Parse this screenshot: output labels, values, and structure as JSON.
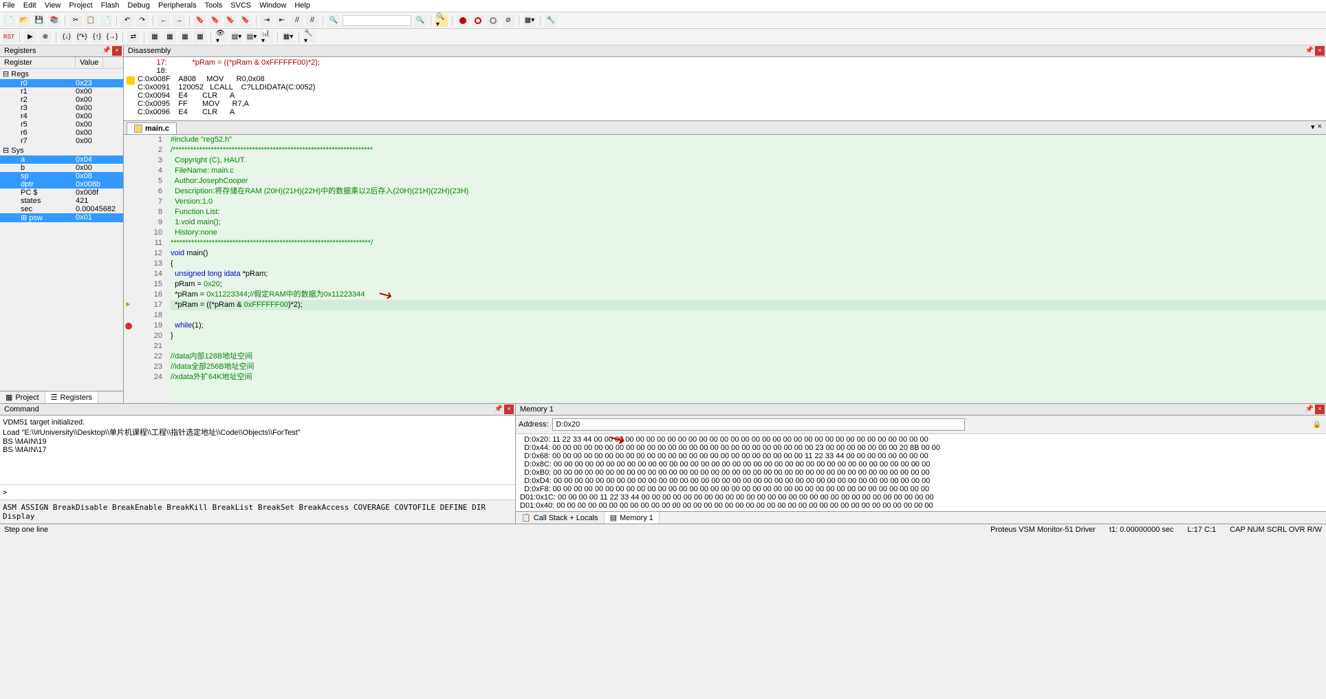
{
  "menu": [
    "File",
    "Edit",
    "View",
    "Project",
    "Flash",
    "Debug",
    "Peripherals",
    "Tools",
    "SVCS",
    "Window",
    "Help"
  ],
  "registers": {
    "title": "Registers",
    "header": [
      "Register",
      "Value"
    ],
    "groups": [
      {
        "name": "Regs",
        "rows": [
          {
            "n": "r0",
            "v": "0x23",
            "sel": true
          },
          {
            "n": "r1",
            "v": "0x00"
          },
          {
            "n": "r2",
            "v": "0x00"
          },
          {
            "n": "r3",
            "v": "0x00"
          },
          {
            "n": "r4",
            "v": "0x00"
          },
          {
            "n": "r5",
            "v": "0x00"
          },
          {
            "n": "r6",
            "v": "0x00"
          },
          {
            "n": "r7",
            "v": "0x00"
          }
        ]
      },
      {
        "name": "Sys",
        "rows": [
          {
            "n": "a",
            "v": "0x04",
            "sel": true
          },
          {
            "n": "b",
            "v": "0x00"
          },
          {
            "n": "sp",
            "v": "0x08",
            "sel": true
          },
          {
            "n": "dptr",
            "v": "0x008b",
            "sel": true
          },
          {
            "n": "PC  $",
            "v": "0x008f"
          },
          {
            "n": "states",
            "v": "421"
          },
          {
            "n": "sec",
            "v": "0.00045682"
          },
          {
            "n": "psw",
            "v": "0x01",
            "sel": true,
            "exp": true
          }
        ]
      }
    ],
    "tabs": [
      {
        "icon": "app",
        "label": "Project"
      },
      {
        "icon": "reg",
        "label": "Registers",
        "active": true
      }
    ]
  },
  "disasm": {
    "title": "Disassembly",
    "lines": [
      {
        "t": "         17:            *pRam = ((*pRam & 0xFFFFFF00)*2);",
        "col": "#a00"
      },
      {
        "t": "         18: "
      },
      {
        "t": "C:0x008F    A808     MOV      R0,0x08",
        "bp": true
      },
      {
        "t": "C:0x0091    120052   LCALL    C?LLDIDATA(C:0052)"
      },
      {
        "t": "C:0x0094    E4       CLR      A"
      },
      {
        "t": "C:0x0095    FF       MOV      R7,A"
      },
      {
        "t": "C:0x0096    E4       CLR      A"
      }
    ]
  },
  "editor": {
    "tab": "main.c",
    "lines": [
      {
        "n": 1,
        "raw": "#include \"reg52.h\"",
        "cls": "pp"
      },
      {
        "n": 2,
        "raw": "/********************************************************************",
        "cls": "cmt"
      },
      {
        "n": 3,
        "raw": "  Copyright (C), HAUT.",
        "cls": "cmt"
      },
      {
        "n": 4,
        "raw": "  FileName: main.c",
        "cls": "cmt"
      },
      {
        "n": 5,
        "raw": "  Author:JosephCooper",
        "cls": "cmt"
      },
      {
        "n": 6,
        "raw": "  Description:将存储在RAM (20H)(21H)(22H)中的数据乘以2后存入(20H)(21H)(22H)(23H)",
        "cls": "cmt"
      },
      {
        "n": 7,
        "raw": "  Version:1.0",
        "cls": "cmt"
      },
      {
        "n": 8,
        "raw": "  Function List:",
        "cls": "cmt"
      },
      {
        "n": 9,
        "raw": "  1.void main();",
        "cls": "cmt"
      },
      {
        "n": 10,
        "raw": "  History:none",
        "cls": "cmt"
      },
      {
        "n": 11,
        "raw": "********************************************************************/",
        "cls": "cmt"
      },
      {
        "n": 12,
        "html": "<span class='kw'>void</span> main()"
      },
      {
        "n": 13,
        "raw": "{"
      },
      {
        "n": 14,
        "html": "  <span class='kw'>unsigned long</span> <span class='kw'>idata</span> *pRam;"
      },
      {
        "n": 15,
        "html": "  pRam = <span class='num'>0x20</span>;"
      },
      {
        "n": 16,
        "html": "  *pRam = <span class='num'>0x11223344</span>;<span class='cmt'>//假定RAM中的数据为0x11223344</span>"
      },
      {
        "n": 17,
        "html": "  *pRam = ((*pRam & <span class='num'>0xFFFFFF00</span>)*2);",
        "hl": true,
        "arrow": true
      },
      {
        "n": 18,
        "raw": ""
      },
      {
        "n": 19,
        "html": "  <span class='kw'>while</span>(1);",
        "bp": true
      },
      {
        "n": 20,
        "raw": "}"
      },
      {
        "n": 21,
        "raw": ""
      },
      {
        "n": 22,
        "raw": "//data内部128B地址空间",
        "cls": "cmt"
      },
      {
        "n": 23,
        "raw": "//idata全部256B地址空间",
        "cls": "cmt"
      },
      {
        "n": 24,
        "raw": "//xdata外扩64K地址空间",
        "cls": "cmt"
      }
    ]
  },
  "command": {
    "title": "Command",
    "lines": [
      "VDM51 target initialized.",
      "Load \"E:\\\\#University\\\\Desktop\\\\单片机课程\\\\工程\\\\指针选定地址\\\\Code\\\\Objects\\\\ForTest\"",
      "BS \\MAIN\\19",
      "BS \\MAIN\\17"
    ],
    "input": ">",
    "hints": "ASM ASSIGN BreakDisable BreakEnable BreakKill BreakList BreakSet BreakAccess COVERAGE COVTOFILE DEFINE DIR Display"
  },
  "memory": {
    "title": "Memory 1",
    "addr_label": "Address:",
    "addr_value": "D:0x20",
    "lines": [
      "  D:0x20: 11 22 33 44 00 00 00 00 00 00 00 00 00 00 00 00 00 00 00 00 00 00 00 00 00 00 00 00 00 00 00 00 00 00 00 00",
      "  D:0x44: 00 00 00 00 00 00 00 00 00 00 00 00 00 00 00 00 00 00 00 00 00 00 00 00 00 23 00 00 00 00 00 00 00 20 8B 00 00",
      "  D:0x68: 00 00 00 00 00 00 00 00 00 00 00 00 00 00 00 00 00 00 00 00 00 00 00 00 11 22 33 44 00 00 00 00 00 00 00 00",
      "  D:0x8C: 00 00 00 00 00 00 00 00 00 00 00 00 00 00 00 00 00 00 00 00 00 00 00 00 00 00 00 00 00 00 00 00 00 00 00 00",
      "  D:0xB0: 00 00 00 00 00 00 00 00 00 00 00 00 00 00 00 00 00 00 00 00 00 00 00 00 00 00 00 00 00 00 00 00 00 00 00 00",
      "  D:0xD4: 00 00 00 00 00 00 00 00 00 00 00 00 00 00 00 00 00 00 00 00 00 00 00 00 00 00 00 00 00 00 00 00 00 00 00 00",
      "  D:0xF8: 00 00 00 00 00 00 00 00 00 00 00 00 00 00 00 00 00 00 00 00 00 00 00 00 00 00 00 00 00 00 00 00 00 00 00 00",
      "D01:0x1C: 00 00 00 00 11 22 33 44 00 00 00 00 00 00 00 00 00 00 00 00 00 00 00 00 00 00 00 00 00 00 00 00 00 00 00 00",
      "D01:0x40: 00 00 00 00 00 00 00 00 00 00 00 00 00 00 00 00 00 00 00 00 00 00 00 00 00 00 00 00 00 00 00 00 00 00 00 00"
    ],
    "tabs": [
      {
        "label": "Call Stack + Locals"
      },
      {
        "label": "Memory 1",
        "active": true
      }
    ]
  },
  "statusbar": {
    "left": "Step one line",
    "driver": "Proteus VSM Monitor-51 Driver",
    "time": "t1: 0.00000000 sec",
    "pos": "L:17 C:1",
    "ind": "CAP  NUM  SCRL  OVR  R/W"
  }
}
